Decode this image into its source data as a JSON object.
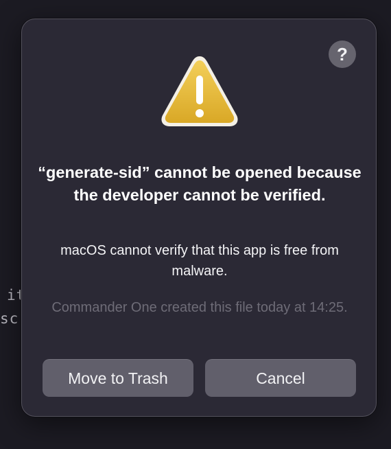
{
  "background": {
    "text_lines": [
      "it",
      "sc"
    ]
  },
  "dialog": {
    "help_label": "?",
    "icon": "warning-triangle-icon",
    "title": "“generate-sid” cannot be opened because the developer cannot be verified.",
    "message": "macOS cannot verify that this app is free from malware.",
    "info": "Commander One created this file today at 14:25.",
    "buttons": {
      "move_to_trash": "Move to Trash",
      "cancel": "Cancel"
    }
  },
  "colors": {
    "dialog_bg": "#2b2935",
    "button_bg": "#615f6b",
    "warning_fill": "#e8b93b"
  }
}
